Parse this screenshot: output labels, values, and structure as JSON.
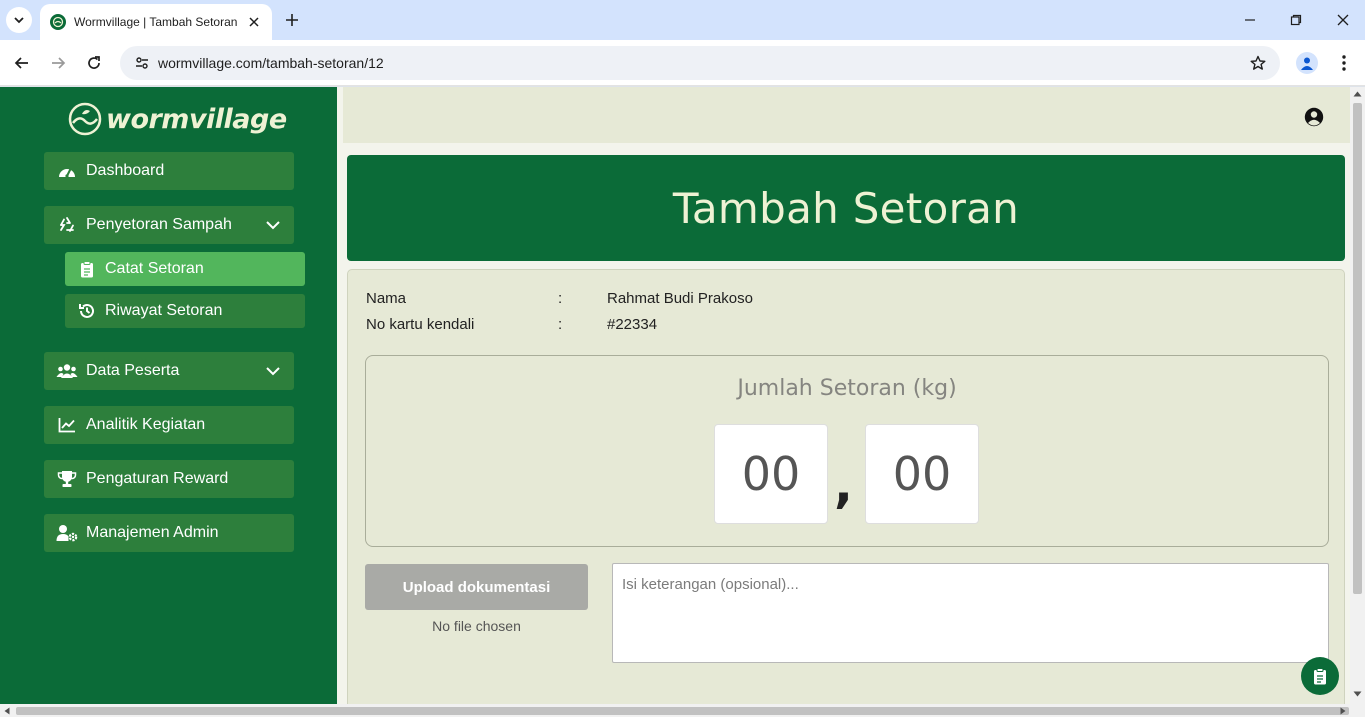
{
  "browser": {
    "tab_title": "Wormvillage | Tambah Setoran",
    "url": "wormvillage.com/tambah-setoran/12"
  },
  "sidebar": {
    "logo_text": "wormvillage",
    "items": [
      {
        "label": "Dashboard",
        "icon": "gauge-icon"
      },
      {
        "label": "Penyetoran Sampah",
        "icon": "recycle-icon",
        "expanded": true
      },
      {
        "label": "Data Peserta",
        "icon": "users-icon",
        "expanded": false
      },
      {
        "label": "Analitik Kegiatan",
        "icon": "chart-line-icon"
      },
      {
        "label": "Pengaturan Reward",
        "icon": "trophy-icon"
      },
      {
        "label": "Manajemen Admin",
        "icon": "user-gear-icon"
      }
    ],
    "sub_items": [
      {
        "label": "Catat Setoran",
        "icon": "clipboard-icon",
        "active": true
      },
      {
        "label": "Riwayat Setoran",
        "icon": "history-icon",
        "active": false
      }
    ]
  },
  "page": {
    "title": "Tambah Setoran",
    "info": [
      {
        "label": "Nama",
        "separator": ":",
        "value": "Rahmat Budi Prakoso"
      },
      {
        "label": "No kartu kendali",
        "separator": ":",
        "value": "#22334"
      }
    ],
    "quantity": {
      "title": "Jumlah Setoran (kg)",
      "integer_part": "00",
      "decimal_separator": ",",
      "decimal_part": "00"
    },
    "upload": {
      "button_label": "Upload dokumentasi",
      "status": "No file chosen"
    },
    "note": {
      "placeholder": "Isi keterangan (opsional)...",
      "value": ""
    }
  },
  "colors": {
    "primary": "#0b6b38",
    "menu_item": "#2d7f3c",
    "menu_active": "#52b65c",
    "surface": "#e6e9d6",
    "disabled_button": "#a9aaa6"
  }
}
